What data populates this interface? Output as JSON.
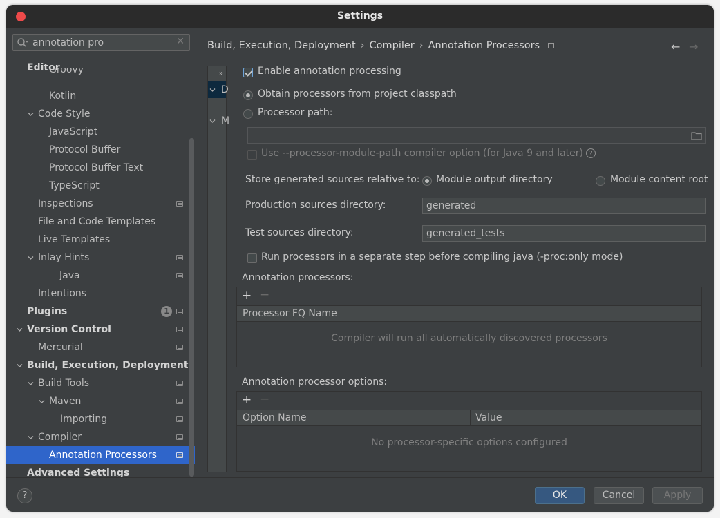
{
  "window": {
    "title": "Settings"
  },
  "search": {
    "value": "annotation pro"
  },
  "tree": [
    {
      "label": "Editor",
      "bold": true
    },
    {
      "label": "Groovy"
    },
    {
      "label": "Kotlin"
    },
    {
      "label": "Code Style",
      "expanded": true
    },
    {
      "label": "JavaScript"
    },
    {
      "label": "Protocol Buffer"
    },
    {
      "label": "Protocol Buffer Text"
    },
    {
      "label": "TypeScript"
    },
    {
      "label": "Inspections",
      "project": true
    },
    {
      "label": "File and Code Templates"
    },
    {
      "label": "Live Templates"
    },
    {
      "label": "Inlay Hints",
      "expanded": true,
      "project": true
    },
    {
      "label": "Java",
      "project": true
    },
    {
      "label": "Intentions"
    },
    {
      "label": "Plugins",
      "bold": true,
      "badge": "1",
      "project": true
    },
    {
      "label": "Version Control",
      "bold": true,
      "expanded": true,
      "project": true
    },
    {
      "label": "Mercurial",
      "project": true
    },
    {
      "label": "Build, Execution, Deployment",
      "bold": true,
      "expanded": true
    },
    {
      "label": "Build Tools",
      "expanded": true,
      "project": true
    },
    {
      "label": "Maven",
      "expanded": true,
      "project": true
    },
    {
      "label": "Importing",
      "project": true
    },
    {
      "label": "Compiler",
      "expanded": true,
      "project": true
    },
    {
      "label": "Annotation Processors",
      "selected": true,
      "project": true
    },
    {
      "label": "Advanced Settings",
      "bold": true
    }
  ],
  "breadcrumb": {
    "part1": "Build, Execution, Deployment",
    "part2": "Compiler",
    "part3": "Annotation Processors",
    "sep": "›"
  },
  "modules": {
    "expand": "»",
    "row1": "D",
    "row2": "M"
  },
  "form": {
    "enable_label": "Enable annotation processing",
    "obtain_label": "Obtain processors from project classpath",
    "path_label": "Processor path:",
    "module_path_label": "Use --processor-module-path compiler option (for Java 9 and later)",
    "store_label": "Store generated sources relative to:",
    "module_output_label": "Module output directory",
    "module_content_label": "Module content root",
    "prod_label": "Production sources directory:",
    "prod_value": "generated",
    "test_label": "Test sources directory:",
    "test_value": "generated_tests",
    "run_separate_label": "Run processors in a separate step before compiling java (-proc:only mode)",
    "processors_title": "Annotation processors:",
    "processor_col": "Processor FQ Name",
    "processors_empty": "Compiler will run all automatically discovered processors",
    "options_title": "Annotation processor options:",
    "option_col": "Option Name",
    "value_col": "Value",
    "options_empty": "No processor-specific options configured",
    "plus": "+",
    "minus": "−"
  },
  "footer": {
    "help": "?",
    "ok": "OK",
    "cancel": "Cancel",
    "apply": "Apply"
  },
  "colors": {
    "selection": "#2f65ca",
    "default_button": "#365880",
    "close": "#ee4a4a"
  }
}
